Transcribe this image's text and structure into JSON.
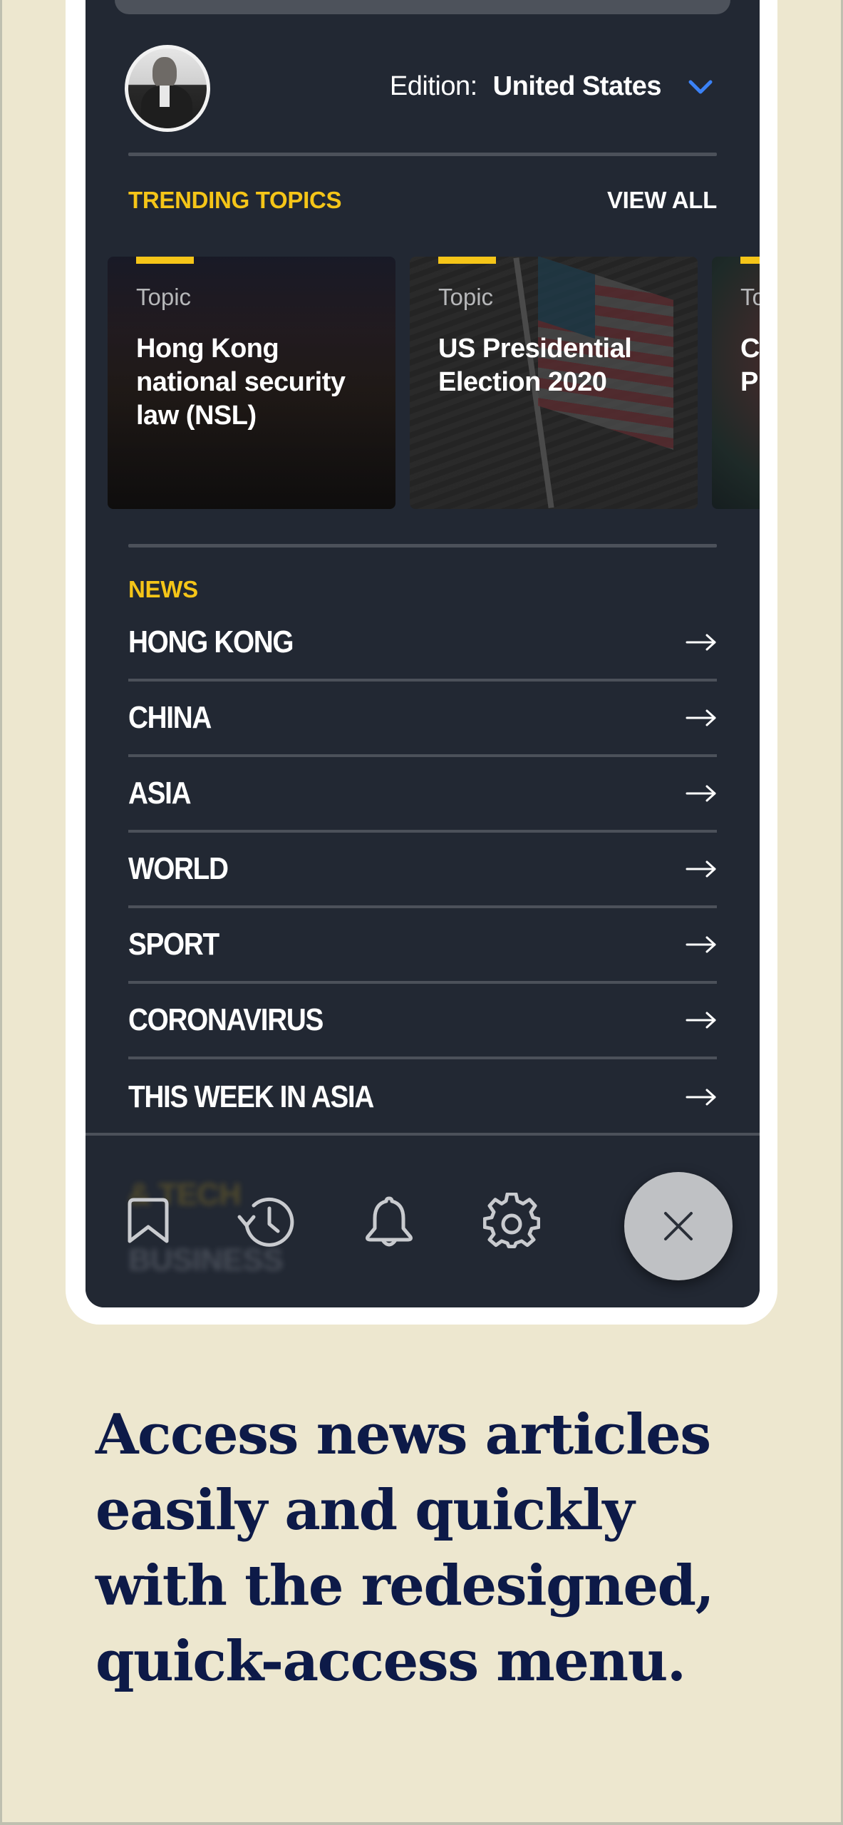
{
  "profile": {
    "avatar_alt": "User avatar"
  },
  "edition": {
    "label": "Edition:",
    "value": "United States",
    "chevron_icon": "chevron-down-icon"
  },
  "trending": {
    "title": "TRENDING TOPICS",
    "view_all": "VIEW ALL",
    "cards": [
      {
        "kind": "Topic",
        "title": "Hong Kong national security law (NSL)"
      },
      {
        "kind": "Topic",
        "title": "US Presidential Election 2020"
      },
      {
        "kind": "To",
        "title": "C P"
      }
    ]
  },
  "news": {
    "title": "NEWS",
    "items": [
      {
        "label": "HONG KONG",
        "icon": "arrow-right-icon"
      },
      {
        "label": "CHINA",
        "icon": "arrow-right-icon"
      },
      {
        "label": "ASIA",
        "icon": "arrow-right-icon"
      },
      {
        "label": "WORLD",
        "icon": "arrow-right-icon"
      },
      {
        "label": "SPORT",
        "icon": "arrow-right-icon"
      },
      {
        "label": "CORONAVIRUS",
        "icon": "arrow-right-icon"
      },
      {
        "label": "THIS WEEK IN ASIA",
        "icon": "arrow-right-icon"
      }
    ]
  },
  "bottom_bar": {
    "background_ghost_text": [
      "& TECH",
      "BUSINESS"
    ],
    "icons": [
      "bookmark-icon",
      "history-icon",
      "bell-icon",
      "gear-icon"
    ],
    "close_icon": "close-icon"
  },
  "caption": "Access news articles easily and quickly with the redesigned, quick-access menu.",
  "colors": {
    "page_background": "#ede7cf",
    "screen_background": "#222833",
    "accent_yellow": "#f5c518",
    "chevron_blue": "#3b82f6",
    "caption_navy": "#0d1a48",
    "close_button": "#bfc1c4"
  }
}
